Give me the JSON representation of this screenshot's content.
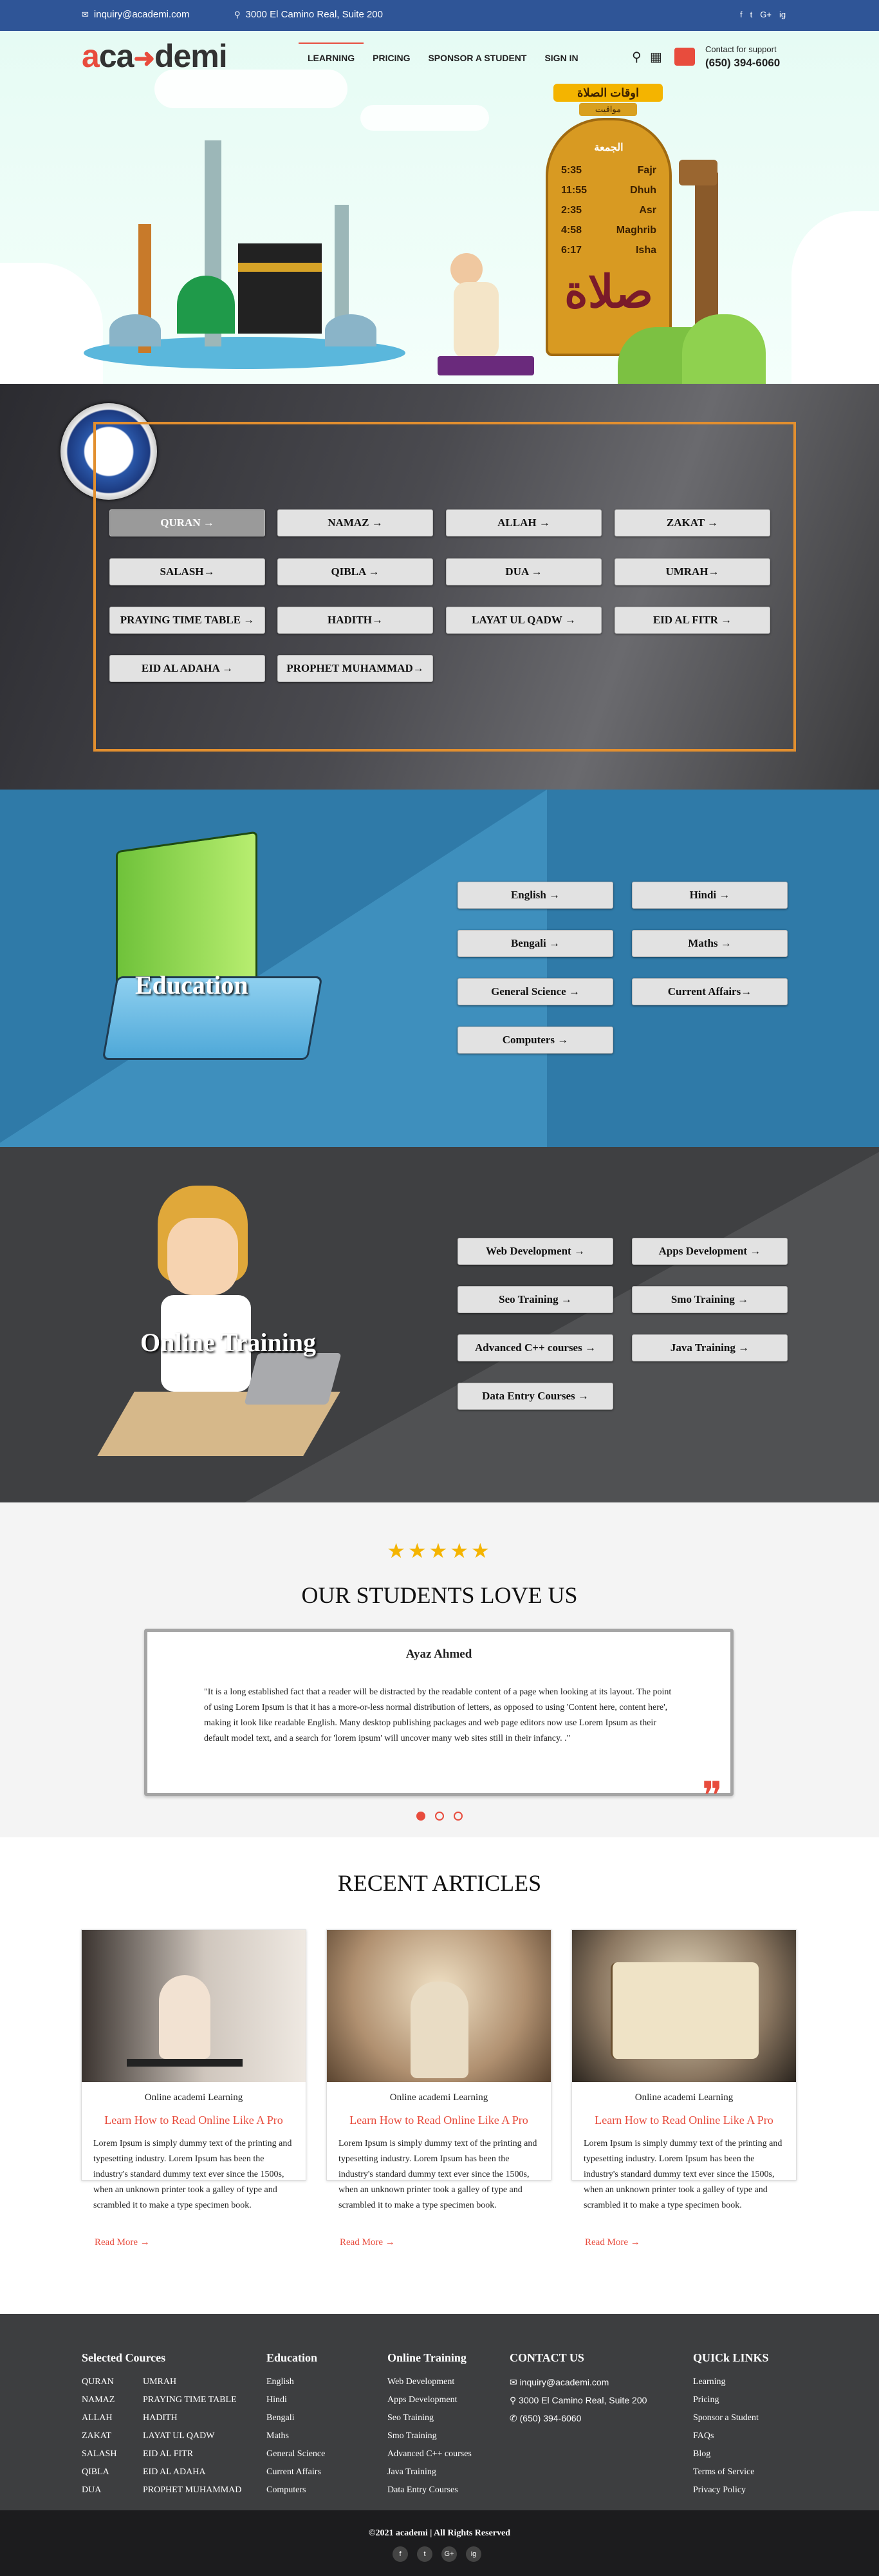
{
  "topbar": {
    "email": "inquiry@academi.com",
    "address": "3000 El Camino Real, Suite 200",
    "social": [
      "f",
      "t",
      "G+",
      "ig"
    ]
  },
  "header": {
    "logo": {
      "a": "a",
      "rest": "ca",
      "rest2": "demi"
    },
    "nav": [
      "LEARNING",
      "PRICING",
      "SPONSOR A STUDENT",
      "SIGN IN"
    ],
    "support_label": "Contact for support",
    "support_phone": "(650) 394-6060"
  },
  "prayer_board": {
    "title": "اوقات الصلاة",
    "subtitle": "مواقيت",
    "day": "الجمعة",
    "times": [
      {
        "time": "5:35",
        "name": "Fajr"
      },
      {
        "time": "11:55",
        "name": "Dhuh"
      },
      {
        "time": "2:35",
        "name": "Asr"
      },
      {
        "time": "4:58",
        "name": "Maghrib"
      },
      {
        "time": "6:17",
        "name": "Isha"
      }
    ],
    "calligraphy": "صلاة"
  },
  "islamic_courses": [
    "QURAN →",
    "NAMAZ →",
    "ALLAH →",
    "ZAKAT →",
    "SALASH→",
    "QIBLA →",
    "DUA →",
    "UMRAH→",
    "PRAYING TIME TABLE →",
    "HADITH→",
    "LAYAT UL QADW →",
    "EID AL FITR →",
    "EID AL ADAHA →",
    "PROPHET MUHAMMAD→"
  ],
  "education": {
    "title": "Education",
    "courses": [
      "English →",
      "Hindi →",
      "Bengali →",
      "Maths →",
      "General Science →",
      "Current Affairs→",
      "Computers →"
    ]
  },
  "training": {
    "title": "Online Training",
    "courses": [
      "Web Development →",
      "Apps Development →",
      "Seo Training →",
      "Smo Training →",
      "Advanced C++ courses →",
      "Java Training →",
      "Data Entry Courses →"
    ]
  },
  "testimonials": {
    "title": "OUR STUDENTS LOVE US",
    "name": "Ayaz Ahmed",
    "text": "\"It is a long established fact that a reader will be distracted by the readable content of a page when looking at its layout. The point of using Lorem Ipsum is that it has a more-or-less normal distribution of letters, as opposed to using 'Content here, content here', making it look like readable English. Many desktop publishing packages and web page editors now use Lorem Ipsum as their default model text, and a search for 'lorem ipsum' will uncover many web sites still in their infancy. .\"",
    "rating": 5,
    "stars": "★★★★★",
    "quote_mark": "❞"
  },
  "articles": {
    "title": "RECENT ARTICLES",
    "items": [
      {
        "category": "Online academi Learning",
        "title": "Learn How to Read Online Like A Pro",
        "text": "Lorem Ipsum is simply dummy text of the printing and typesetting industry. Lorem Ipsum has been the industry's standard dummy text ever since the 1500s, when an unknown printer took a galley of type and scrambled it to make a type specimen book.",
        "more": "Read More →"
      },
      {
        "category": "Online academi Learning",
        "title": "Learn How to Read Online Like A Pro",
        "text": "Lorem Ipsum is simply dummy text of the printing and typesetting industry. Lorem Ipsum has been the industry's standard dummy text ever since the 1500s, when an unknown printer took a galley of type and scrambled it to make a type specimen book.",
        "more": "Read More →"
      },
      {
        "category": "Online academi Learning",
        "title": "Learn How to Read Online Like A Pro",
        "text": "Lorem Ipsum is simply dummy text of the printing and typesetting industry. Lorem Ipsum has been the industry's standard dummy text ever since the 1500s, when an unknown printer took a galley of type and scrambled it to make a type specimen book.",
        "more": "Read More →"
      }
    ]
  },
  "footer": {
    "selected_title": "Selected Cources",
    "selected_col1": [
      "QURAN",
      "NAMAZ",
      "ALLAH",
      "ZAKAT",
      "SALASH",
      "QIBLA",
      "DUA"
    ],
    "selected_col2": [
      "UMRAH",
      "PRAYING TIME TABLE",
      "HADITH",
      "LAYAT UL QADW",
      "EID AL FITR",
      "EID AL ADAHA",
      "PROPHET MUHAMMAD"
    ],
    "education_title": "Education",
    "education": [
      "English",
      "Hindi",
      "Bengali",
      "Maths",
      "General Science",
      "Current Affairs",
      "Computers"
    ],
    "training_title": "Online Training",
    "training": [
      "Web Development",
      "Apps Development",
      "Seo Training",
      "Smo Training",
      "Advanced C++ courses",
      "Java Training",
      "Data Entry Courses"
    ],
    "contact_title": "CONTACT US",
    "contact": [
      "inquiry@academi.com",
      "3000 El Camino Real, Suite 200",
      "(650) 394-6060"
    ],
    "quick_title": "QUICk LINKS",
    "quick": [
      "Learning",
      "Pricing",
      "Sponsor a Student",
      "FAQs",
      "Blog",
      "Terms of Service",
      "Privacy Policy"
    ],
    "copyright": "©2021 academi | All Rights Reserved",
    "social": [
      "f",
      "t",
      "G+",
      "ig"
    ]
  },
  "colors": {
    "accent": "#e84c3d",
    "topbar": "#2f5597",
    "edu_bg": "#2f7aa8",
    "training_bg": "#3f4042",
    "footer": "#3d3e40"
  }
}
